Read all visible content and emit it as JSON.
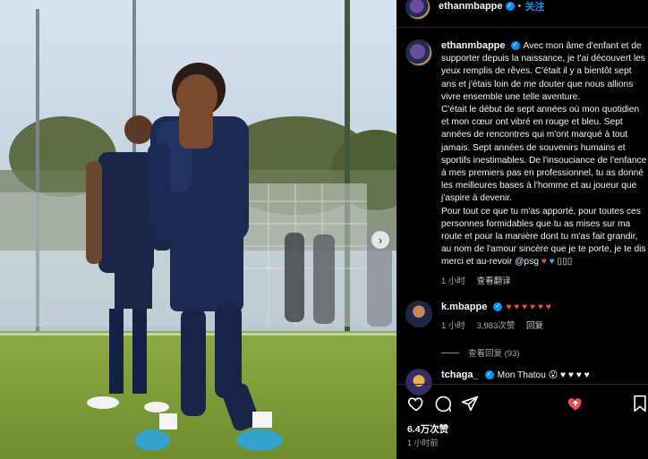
{
  "post": {
    "author": "ethanmbappe",
    "follow_label": "关注",
    "caption": "Avec mon âme d'enfant et de supporter depuis la naissance, je t'ai découvert les yeux remplis de rêves. C'était il y a bientôt sept ans et j'étais loin de me douter que nous allions vivre ensemble une telle aventure.\nC'était le début de sept années où mon quotidien et mon cœur ont vibré en rouge et bleu. Sept années de rencontres qui m'ont marqué à tout jamais. Sept années de souvenirs humains et sportifs inestimables. De l'insouciance de l'enfance à mes premiers pas en professionnel, tu as donné les meilleures bases à l'homme et au joueur que j'aspire à devenir.\nPour tout ce que tu m'as apporté, pour toutes ces personnes formidables que tu as mises sur ma route et pour la manière dont tu m'as fait grandir, au nom de l'amour sincère que je te porte, je te dis merci et au-revoir ",
    "caption_mention": "@psg",
    "caption_emojis": "♥ ♥ ",
    "caption_emojis_tail": "▯▯▯",
    "caption_time": "1 小时",
    "see_translation": "查看翻译",
    "likes": "6.4万次赞",
    "time_ago": "1 小时前"
  },
  "comments": [
    {
      "user": "k.mbappe",
      "text": "♥ ♥ ♥ ♥ ♥ ♥",
      "time": "1 小时",
      "likes": "3,983次赞",
      "reply_label": "回复",
      "view_replies": "查看回复 (93)"
    },
    {
      "user": "tchaga_",
      "text": "Mon Thatou 😮 ♥ ♥ ♥ ♥"
    }
  ],
  "icons": {
    "verified": "verified-badge-icon",
    "like": "heart-icon",
    "comment": "comment-icon",
    "share": "send-icon",
    "save": "bookmark-icon",
    "next": "chevron-right-icon"
  },
  "colors": {
    "accent": "#0095f6",
    "heart": "#ed4956",
    "psg_blue": "#1c2548"
  }
}
